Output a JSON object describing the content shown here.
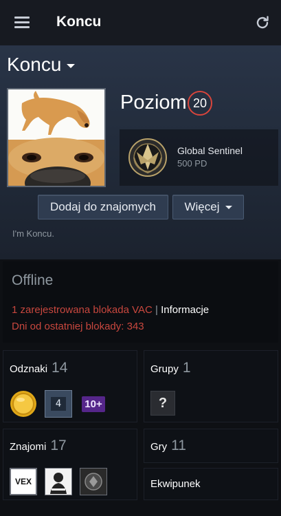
{
  "header": {
    "title": "Koncu"
  },
  "profile": {
    "persona_name": "Koncu",
    "level_label": "Poziom",
    "level": "20",
    "badge": {
      "name": "Global Sentinel",
      "xp": "500 PD"
    },
    "add_friend_label": "Dodaj do znajomych",
    "more_label": "Więcej",
    "summary": "I'm Koncu."
  },
  "status": {
    "title": "Offline",
    "vac_text": "1 zarejestrowana blokada VAC",
    "separator": "|",
    "info_link": "Informacje",
    "days_text": "Dni od ostatniej blokady: 343"
  },
  "badges": {
    "label": "Odznaki",
    "count": "14",
    "items": [
      "gold-coin",
      "4",
      "10+"
    ]
  },
  "groups": {
    "label": "Grupy",
    "count": "1",
    "item": "?"
  },
  "friends": {
    "label": "Znajomi",
    "count": "17",
    "items": [
      "VEX",
      "person",
      "emblem"
    ]
  },
  "games": {
    "label": "Gry",
    "count": "11"
  },
  "inventory": {
    "label": "Ekwipunek"
  },
  "colors": {
    "accent_red": "#c8473e",
    "level_ring": "#d9453c",
    "topbar": "#171a21"
  }
}
